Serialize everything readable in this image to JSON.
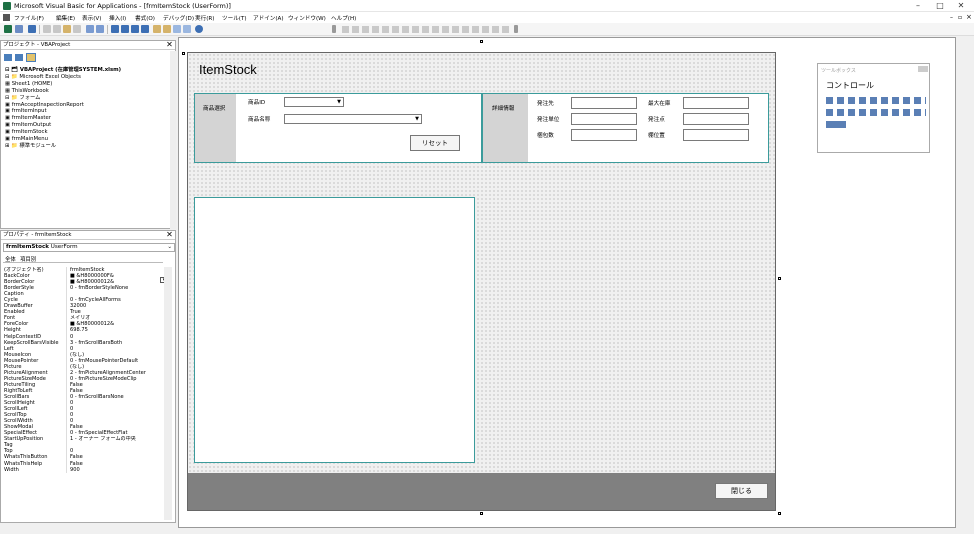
{
  "window": {
    "title": "Microsoft Visual Basic for Applications - [frmItemStock (UserForm)]",
    "min": "–",
    "max": "□",
    "close": "✕",
    "inner_min": "–",
    "inner_restore": "▫",
    "inner_close": "×"
  },
  "menu": [
    "ファイル(F)",
    "編集(E)",
    "表示(V)",
    "挿入(I)",
    "書式(O)",
    "デバッグ(D)",
    "実行(R)",
    "ツール(T)",
    "アドイン(A)",
    "ウィンドウ(W)",
    "ヘルプ(H)"
  ],
  "project": {
    "title": "プロジェクト - VBAProject",
    "close": "✕",
    "tree": [
      "⊟ 🗂 VBAProject (在庫管理SYSTEM.xlsm)",
      "   ⊟ 📁 Microsoft Excel Objects",
      "        ▦ Sheet1 (HOME)",
      "        ▦ ThisWorkbook",
      "   ⊟ 📁 フォーム",
      "        ▣ frmAcceptInspectionReport",
      "        ▣ frmItemInput",
      "        ▣ frmItemMaster",
      "        ▣ frmItemOutput",
      "        ▣ frmItemStock",
      "        ▣ frmMainMenu",
      "   ⊞ 📁 標準モジュール"
    ]
  },
  "properties": {
    "title": "プロパティ - frmItemStock",
    "close": "✕",
    "object": "frmItemStock",
    "object_type": "UserForm",
    "tabs": [
      "全体",
      "項目別"
    ],
    "rows": [
      [
        "(オブジェクト名)",
        "frmItemStock"
      ],
      [
        "BackColor",
        "■ &H8000000F&"
      ],
      [
        "BorderColor",
        "■ &H80000012&"
      ],
      [
        "BorderStyle",
        "0 - fmBorderStyleNone"
      ],
      [
        "Caption",
        ""
      ],
      [
        "Cycle",
        "0 - fmCycleAllForms"
      ],
      [
        "DrawBuffer",
        "32000"
      ],
      [
        "Enabled",
        "True"
      ],
      [
        "Font",
        "メイリオ"
      ],
      [
        "ForeColor",
        "■ &H80000012&"
      ],
      [
        "Height",
        "698.75"
      ],
      [
        "HelpContextID",
        "0"
      ],
      [
        "KeepScrollBarsVisible",
        "3 - fmScrollBarsBoth"
      ],
      [
        "Left",
        "0"
      ],
      [
        "MouseIcon",
        "(なし)"
      ],
      [
        "MousePointer",
        "0 - fmMousePointerDefault"
      ],
      [
        "Picture",
        "(なし)"
      ],
      [
        "PictureAlignment",
        "2 - fmPictureAlignmentCenter"
      ],
      [
        "PictureSizeMode",
        "0 - fmPictureSizeModeClip"
      ],
      [
        "PictureTiling",
        "False"
      ],
      [
        "RightToLeft",
        "False"
      ],
      [
        "ScrollBars",
        "0 - fmScrollBarsNone"
      ],
      [
        "ScrollHeight",
        "0"
      ],
      [
        "ScrollLeft",
        "0"
      ],
      [
        "ScrollTop",
        "0"
      ],
      [
        "ScrollWidth",
        "0"
      ],
      [
        "ShowModal",
        "False"
      ],
      [
        "SpecialEffect",
        "0 - fmSpecialEffectFlat"
      ],
      [
        "StartUpPosition",
        "1 - オーナー フォームの中央"
      ],
      [
        "Tag",
        ""
      ],
      [
        "Top",
        "0"
      ],
      [
        "WhatsThisButton",
        "False"
      ],
      [
        "WhatsThisHelp",
        "False"
      ],
      [
        "Width",
        "900"
      ]
    ]
  },
  "form": {
    "heading": "ItemStock",
    "close": "✕",
    "select_label": "商品選択",
    "item_id_label": "商品ID",
    "item_name_label": "商品名称",
    "reset_button": "リセット",
    "detail_label": "詳細情報",
    "supplier_label": "発注先",
    "order_unit_label": "発注単位",
    "inspection_label": "梱包数",
    "max_stock_label": "最大在庫",
    "order_point_label": "発注点",
    "location_label": "棚位置",
    "close_button": "閉じる"
  },
  "toolbox": {
    "title": "ツールボックス",
    "tab": "コントロール"
  },
  "colors": {
    "frame_border": "#3b9b9b",
    "footer": "#808080",
    "label_box": "#d4d4d4"
  }
}
